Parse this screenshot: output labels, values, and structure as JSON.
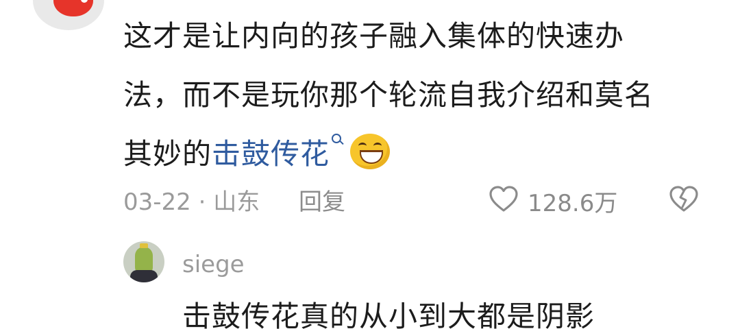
{
  "comment": {
    "line1": "这才是让内向的孩子融入集体的快速办",
    "line2": "法，而不是玩你那个轮流自我介绍和莫名",
    "line3_prefix": "其妙的",
    "line3_link": "击鼓传花",
    "emoji_icon": "grinning-face-emoji",
    "search_icon": "search-icon",
    "link_color": "#2f5b9f"
  },
  "meta": {
    "date_location": "03-22 · 山东",
    "reply_label": "回复",
    "like_count": "128.6万",
    "like_icon": "heart-outline-icon",
    "dislike_icon": "broken-heart-icon"
  },
  "reply": {
    "username": "siege",
    "text": "击鼓传花真的从小到大都是阴影"
  }
}
